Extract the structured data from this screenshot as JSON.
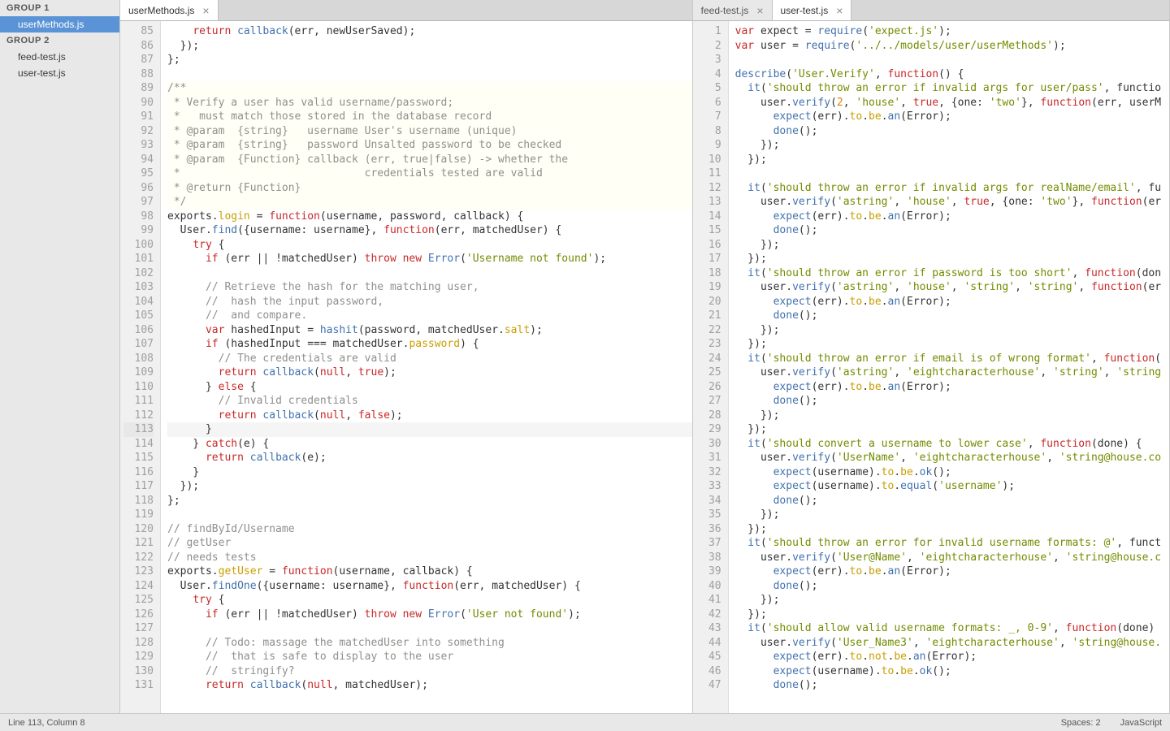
{
  "sidebar": {
    "group1": {
      "label": "GROUP 1",
      "files": [
        {
          "name": "userMethods.js",
          "active": true
        }
      ]
    },
    "group2": {
      "label": "GROUP 2",
      "files": [
        {
          "name": "feed-test.js"
        },
        {
          "name": "user-test.js"
        }
      ]
    }
  },
  "leftPane": {
    "tabs": [
      {
        "name": "userMethods.js",
        "active": true
      }
    ],
    "startLine": 85,
    "lines": [
      "    return callback(err, newUserSaved);",
      "  });",
      "};",
      "",
      "/**",
      " * Verify a user has valid username/password;",
      " *   must match those stored in the database record",
      " * @param  {string}   username User's username (unique)",
      " * @param  {string}   password Unsalted password to be checked",
      " * @param  {Function} callback (err, true|false) -> whether the",
      " *                             credentials tested are valid",
      " * @return {Function}",
      " */",
      "exports.login = function(username, password, callback) {",
      "  User.find({username: username}, function(err, matchedUser) {",
      "    try {",
      "      if (err || !matchedUser) throw new Error('Username not found');",
      "",
      "      // Retrieve the hash for the matching user,",
      "      //  hash the input password,",
      "      //  and compare.",
      "      var hashedInput = hashit(password, matchedUser.salt);",
      "      if (hashedInput === matchedUser.password) {",
      "        // The credentials are valid",
      "        return callback(null, true);",
      "      } else {",
      "        // Invalid credentials",
      "        return callback(null, false);",
      "      }",
      "    } catch(e) {",
      "      return callback(e);",
      "    }",
      "  });",
      "};",
      "",
      "// findById/Username",
      "// getUser",
      "// needs tests",
      "exports.getUser = function(username, callback) {",
      "  User.findOne({username: username}, function(err, matchedUser) {",
      "    try {",
      "      if (err || !matchedUser) throw new Error('User not found');",
      "",
      "      // Todo: massage the matchedUser into something",
      "      //  that is safe to display to the user",
      "      //  stringify?",
      "      return callback(null, matchedUser);"
    ]
  },
  "rightPane": {
    "tabs": [
      {
        "name": "feed-test.js"
      },
      {
        "name": "user-test.js",
        "active": true
      }
    ],
    "startLine": 1,
    "lines": [
      "var expect = require('expect.js');",
      "var user = require('../../models/user/userMethods');",
      "",
      "describe('User.Verify', function() {",
      "  it('should throw an error if invalid args for user/pass', functio",
      "    user.verify(2, 'house', true, {one: 'two'}, function(err, userM",
      "      expect(err).to.be.an(Error);",
      "      done();",
      "    });",
      "  });",
      "",
      "  it('should throw an error if invalid args for realName/email', fu",
      "    user.verify('astring', 'house', true, {one: 'two'}, function(er",
      "      expect(err).to.be.an(Error);",
      "      done();",
      "    });",
      "  });",
      "  it('should throw an error if password is too short', function(don",
      "    user.verify('astring', 'house', 'string', 'string', function(er",
      "      expect(err).to.be.an(Error);",
      "      done();",
      "    });",
      "  });",
      "  it('should throw an error if email is of wrong format', function(",
      "    user.verify('astring', 'eightcharacterhouse', 'string', 'string",
      "      expect(err).to.be.an(Error);",
      "      done();",
      "    });",
      "  });",
      "  it('should convert a username to lower case', function(done) {",
      "    user.verify('UserName', 'eightcharacterhouse', 'string@house.co",
      "      expect(username).to.be.ok();",
      "      expect(username).to.equal('username');",
      "      done();",
      "    });",
      "  });",
      "  it('should throw an error for invalid username formats: @', funct",
      "    user.verify('User@Name', 'eightcharacterhouse', 'string@house.c",
      "      expect(err).to.be.an(Error);",
      "      done();",
      "    });",
      "  });",
      "  it('should allow valid username formats: _, 0-9', function(done)",
      "    user.verify('User_Name3', 'eightcharacterhouse', 'string@house.",
      "      expect(err).to.not.be.an(Error);",
      "      expect(username).to.be.ok();",
      "      done();"
    ]
  },
  "status": {
    "cursor": "Line 113, Column 8",
    "spaces": "Spaces: 2",
    "lang": "JavaScript"
  }
}
